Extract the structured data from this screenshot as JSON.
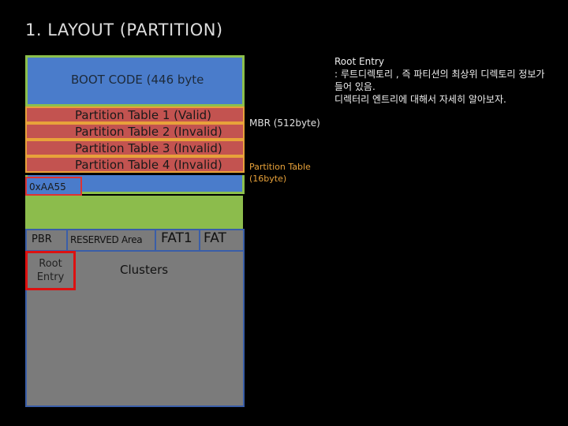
{
  "title": "1. LAYOUT (PARTITION)",
  "mbr": {
    "boot_code": "BOOT CODE (446 byte",
    "partition_tables": [
      "Partition Table 1 (Valid)",
      "Partition Table 2 (Invalid)",
      "Partition Table 3 (Invalid)",
      "Partition Table 4 (Invalid)"
    ],
    "signature": "0xAA55",
    "label": "MBR (512byte)",
    "partition_table_label": "Partition Table (16byte)"
  },
  "pbr": {
    "pbr_label": "PBR",
    "reserved_label": "RESERVED Area",
    "fat1_label": "FAT1",
    "fat_label": "FAT",
    "root_entry_label": "Root Entry",
    "clusters_label": "Clusters"
  },
  "note": {
    "heading": "Root Entry",
    "body": ": 루트디렉토리 , 즉 파티션의 최상위 디렉토리 정보가 들어 있음.\n디렉터리 엔트리에 대해서 자세히 알아보자."
  },
  "colors": {
    "blue": "#4a7ccb",
    "green": "#8cc04c",
    "red": "#c35350",
    "orange": "#e8a23a",
    "gray": "#7b7b7b",
    "highlight_red": "#d11"
  }
}
